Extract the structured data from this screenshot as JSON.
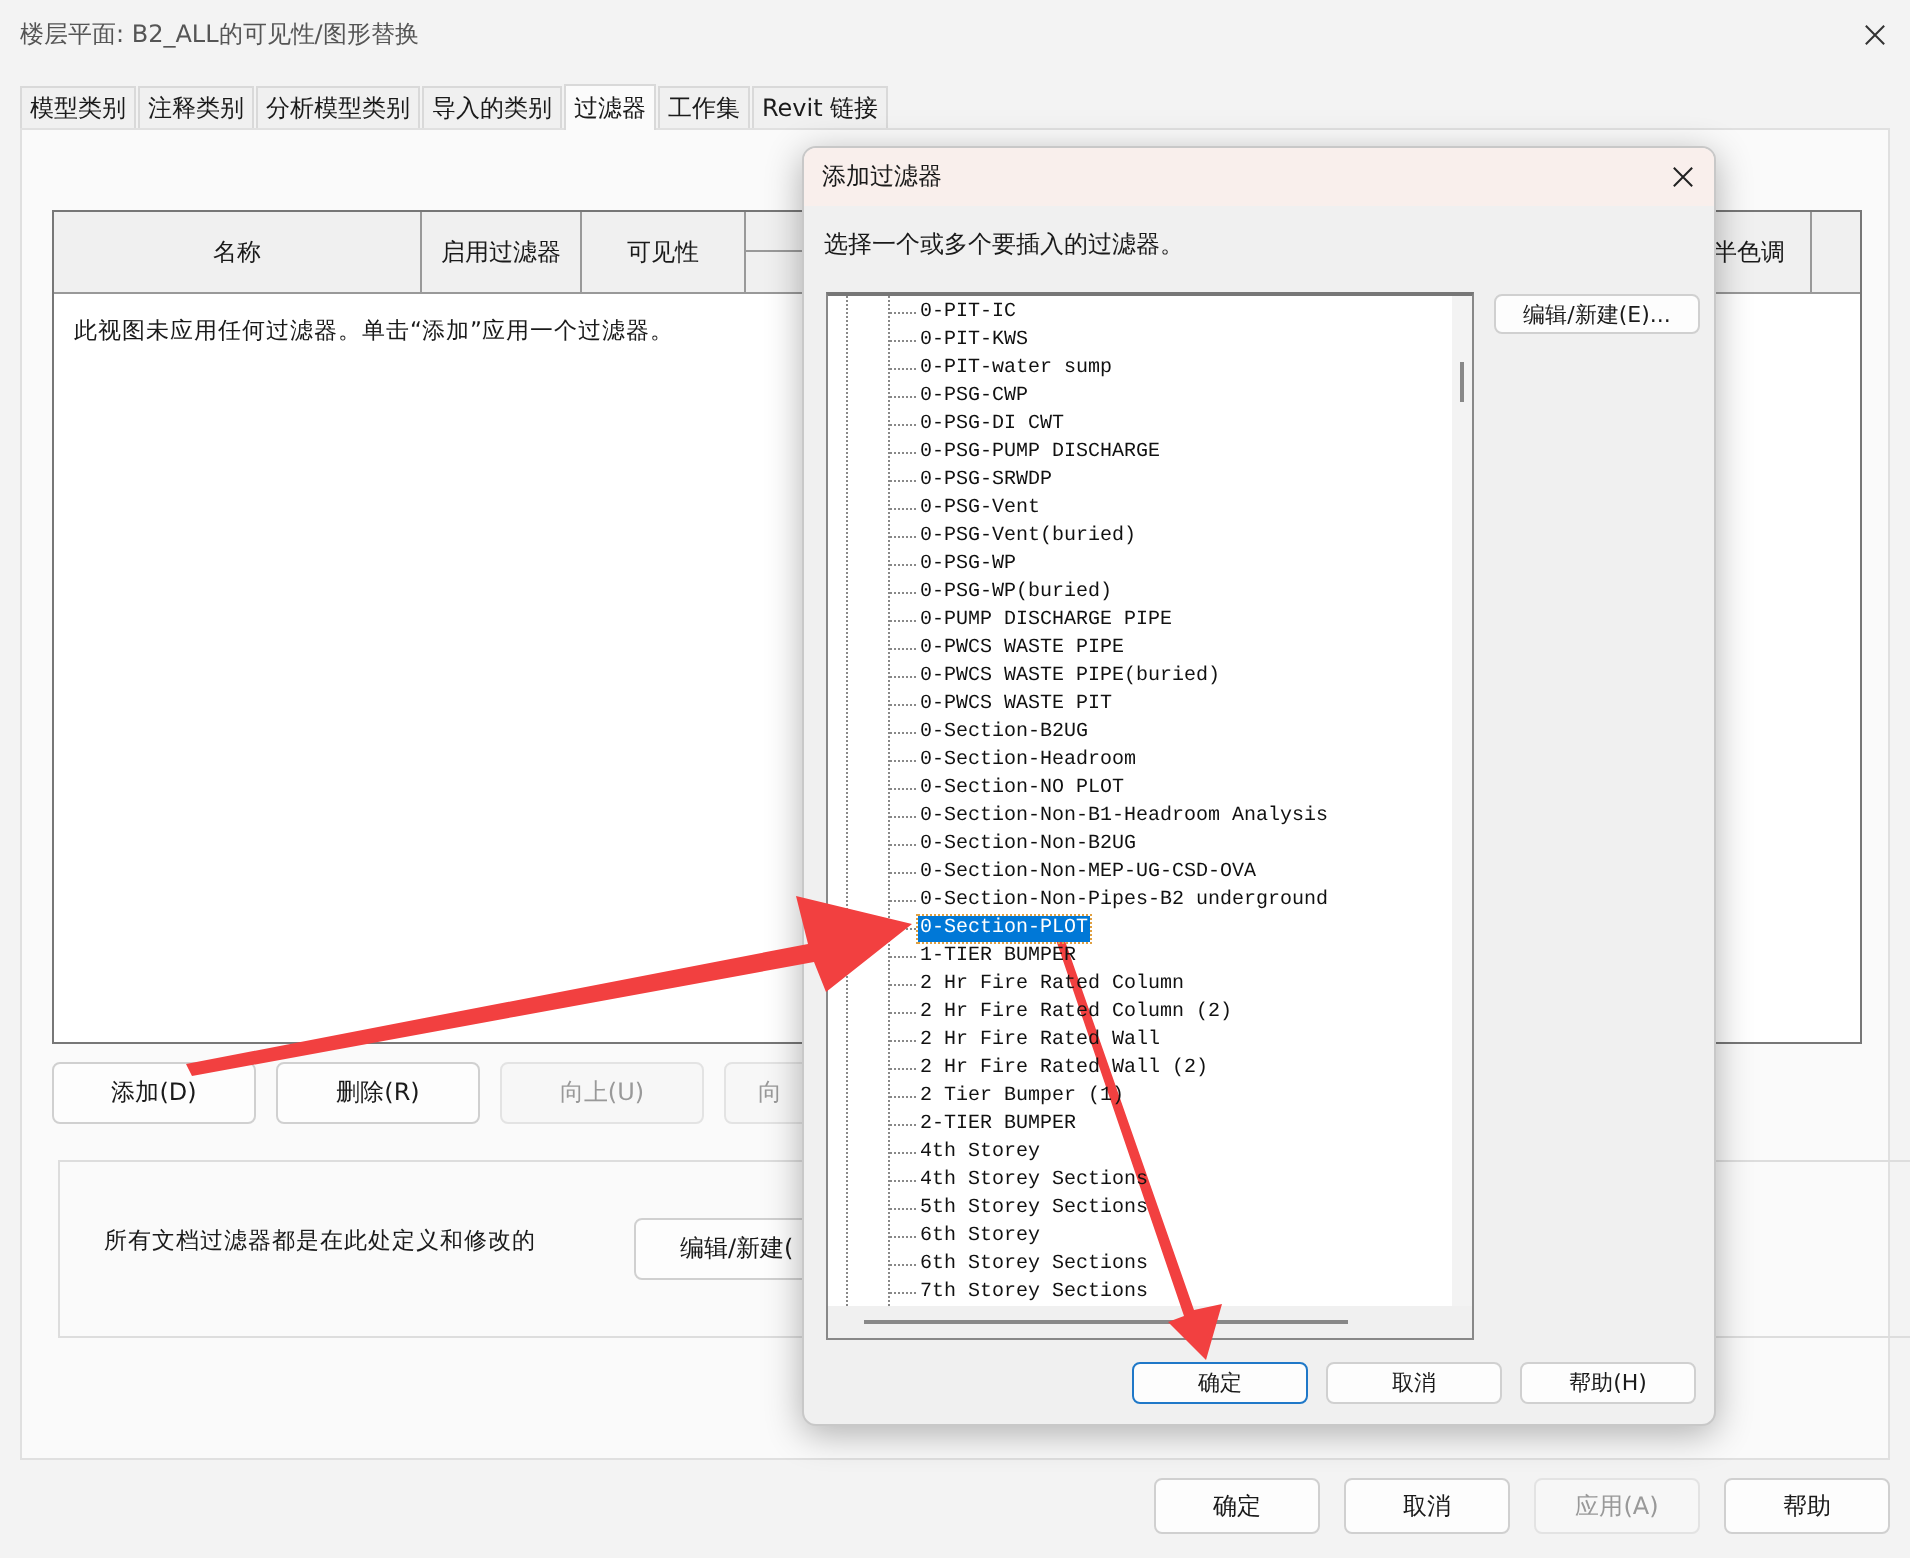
{
  "window": {
    "title": "楼层平面: B2_ALL的可见性/图形替换"
  },
  "tabs": [
    {
      "label": "模型类别",
      "selected": false
    },
    {
      "label": "注释类别",
      "selected": false
    },
    {
      "label": "分析模型类别",
      "selected": false
    },
    {
      "label": "导入的类别",
      "selected": false
    },
    {
      "label": "过滤器",
      "selected": true
    },
    {
      "label": "工作集",
      "selected": false
    },
    {
      "label": "Revit 链接",
      "selected": false
    }
  ],
  "filter_table": {
    "columns": [
      "名称",
      "启用过滤器",
      "可见性"
    ],
    "column_right": "半色调",
    "empty_message": "此视图未应用任何过滤器。单击“添加”应用一个过滤器。"
  },
  "table_buttons": [
    {
      "label": "添加(D)",
      "disabled": false
    },
    {
      "label": "删除(R)",
      "disabled": false
    },
    {
      "label": "向上(U)",
      "disabled": true
    },
    {
      "label": "向",
      "disabled": true
    }
  ],
  "document_filters": {
    "note": "所有文档过滤器都是在此处定义和修改的",
    "button": "编辑/新建("
  },
  "footer_buttons": [
    {
      "label": "确定",
      "disabled": false
    },
    {
      "label": "取消",
      "disabled": false
    },
    {
      "label": "应用(A)",
      "disabled": true
    },
    {
      "label": "帮助",
      "disabled": false
    }
  ],
  "add_filter_dialog": {
    "title": "添加过滤器",
    "instruction": "选择一个或多个要插入的过滤器。",
    "edit_button": "编辑/新建(E)...",
    "items": [
      {
        "label": "0-PIT-IC",
        "selected": false
      },
      {
        "label": "0-PIT-KWS",
        "selected": false
      },
      {
        "label": "0-PIT-water sump",
        "selected": false
      },
      {
        "label": "0-PSG-CWP",
        "selected": false
      },
      {
        "label": "0-PSG-DI CWT",
        "selected": false
      },
      {
        "label": "0-PSG-PUMP DISCHARGE",
        "selected": false
      },
      {
        "label": "0-PSG-SRWDP",
        "selected": false
      },
      {
        "label": "0-PSG-Vent",
        "selected": false
      },
      {
        "label": "0-PSG-Vent(buried)",
        "selected": false
      },
      {
        "label": "0-PSG-WP",
        "selected": false
      },
      {
        "label": "0-PSG-WP(buried)",
        "selected": false
      },
      {
        "label": "0-PUMP DISCHARGE PIPE",
        "selected": false
      },
      {
        "label": "0-PWCS WASTE PIPE",
        "selected": false
      },
      {
        "label": "0-PWCS WASTE PIPE(buried)",
        "selected": false
      },
      {
        "label": "0-PWCS WASTE PIT",
        "selected": false
      },
      {
        "label": "0-Section-B2UG",
        "selected": false
      },
      {
        "label": "0-Section-Headroom",
        "selected": false
      },
      {
        "label": "0-Section-NO PLOT",
        "selected": false
      },
      {
        "label": "0-Section-Non-B1-Headroom Analysis",
        "selected": false
      },
      {
        "label": "0-Section-Non-B2UG",
        "selected": false
      },
      {
        "label": "0-Section-Non-MEP-UG-CSD-OVA",
        "selected": false
      },
      {
        "label": "0-Section-Non-Pipes-B2 underground",
        "selected": false
      },
      {
        "label": "0-Section-PLOT",
        "selected": true
      },
      {
        "label": "1-TIER BUMPER",
        "selected": false
      },
      {
        "label": "2 Hr Fire Rated Column",
        "selected": false
      },
      {
        "label": "2 Hr Fire Rated Column (2)",
        "selected": false
      },
      {
        "label": "2 Hr Fire Rated Wall",
        "selected": false
      },
      {
        "label": "2 Hr Fire Rated Wall (2)",
        "selected": false
      },
      {
        "label": "2 Tier Bumper (1)",
        "selected": false
      },
      {
        "label": "2-TIER BUMPER",
        "selected": false
      },
      {
        "label": "4th Storey",
        "selected": false
      },
      {
        "label": "4th Storey Sections",
        "selected": false
      },
      {
        "label": "5th Storey Sections",
        "selected": false
      },
      {
        "label": "6th Storey",
        "selected": false
      },
      {
        "label": "6th Storey Sections",
        "selected": false
      },
      {
        "label": "7th Storey Sections",
        "selected": false
      }
    ],
    "buttons": [
      {
        "label": "确定",
        "default": true
      },
      {
        "label": "取消",
        "default": false
      },
      {
        "label": "帮助(H)",
        "default": false
      }
    ]
  }
}
